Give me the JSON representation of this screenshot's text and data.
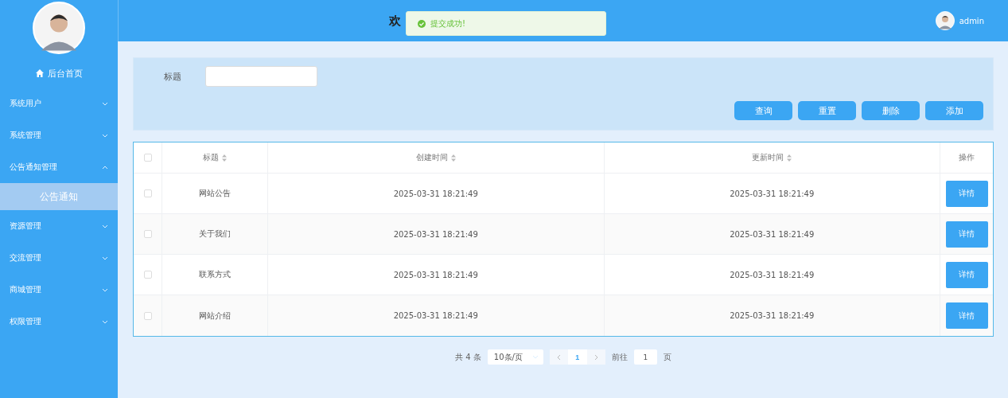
{
  "sidebar": {
    "home": {
      "label": "后台首页"
    },
    "groups": [
      {
        "label": "系统用户",
        "expanded": false
      },
      {
        "label": "系统管理",
        "expanded": false
      },
      {
        "label": "公告通知管理",
        "expanded": true,
        "children": [
          {
            "label": "公告通知",
            "selected": true
          }
        ]
      },
      {
        "label": "资源管理",
        "expanded": false
      },
      {
        "label": "交流管理",
        "expanded": false
      },
      {
        "label": "商城管理",
        "expanded": false
      },
      {
        "label": "权限管理",
        "expanded": false
      }
    ]
  },
  "header": {
    "title": "欢",
    "user": "admin"
  },
  "toast": {
    "message": "提交成功!"
  },
  "search": {
    "label": "标题",
    "buttons": [
      "查询",
      "重置",
      "删除",
      "添加"
    ]
  },
  "table": {
    "header_checked": false,
    "columns": [
      {
        "label": "标题",
        "sortable": true
      },
      {
        "label": "创建时间",
        "sortable": true
      },
      {
        "label": "更新时间",
        "sortable": true
      },
      {
        "label": "操作",
        "sortable": false
      }
    ],
    "rows": [
      {
        "title": "网站公告",
        "created": "2025-03-31 18:21:49",
        "updated": "2025-03-31 18:21:49",
        "action": "详情",
        "checked": false
      },
      {
        "title": "关于我们",
        "created": "2025-03-31 18:21:49",
        "updated": "2025-03-31 18:21:49",
        "action": "详情",
        "checked": false
      },
      {
        "title": "联系方式",
        "created": "2025-03-31 18:21:49",
        "updated": "2025-03-31 18:21:49",
        "action": "详情",
        "checked": false
      },
      {
        "title": "网站介绍",
        "created": "2025-03-31 18:21:49",
        "updated": "2025-03-31 18:21:49",
        "action": "详情",
        "checked": false
      }
    ]
  },
  "pagination": {
    "total": "共 4 条",
    "page_size": "10条/页",
    "pages": [
      {
        "label": "1",
        "selected": true
      }
    ],
    "goto_label": "前往",
    "goto_value": "1",
    "goto_suffix": "页"
  }
}
